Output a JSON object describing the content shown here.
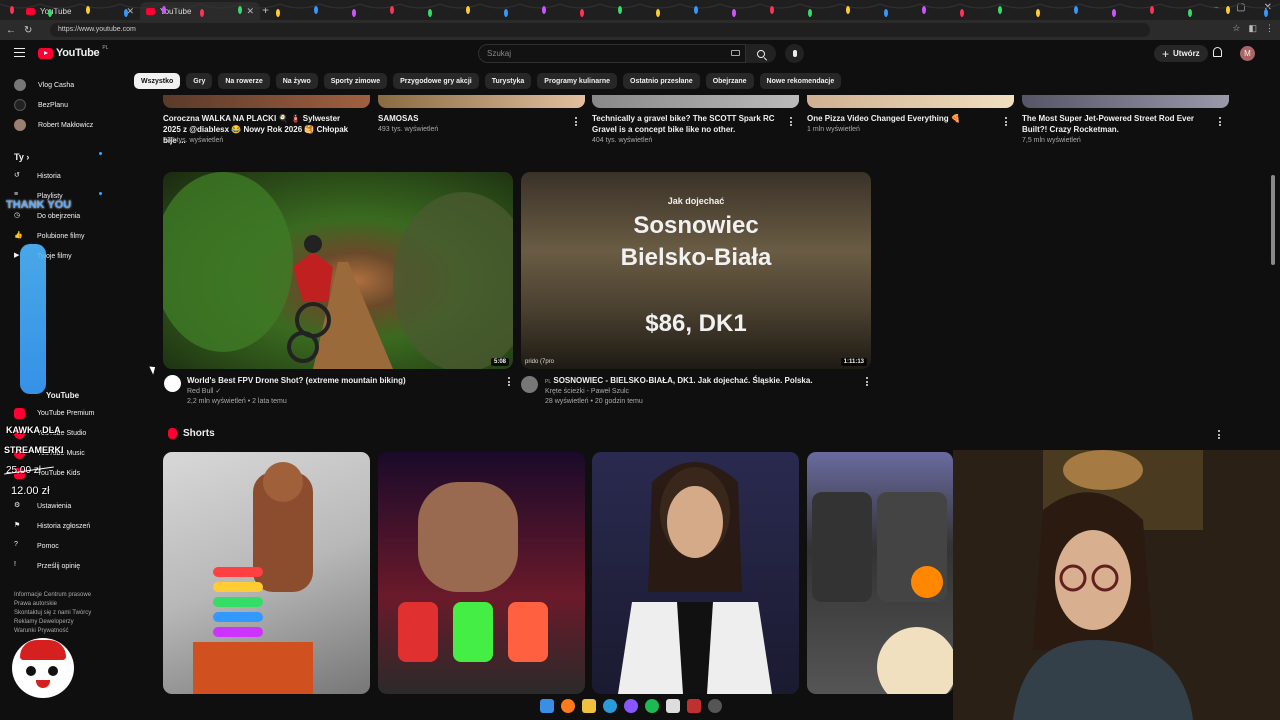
{
  "browser": {
    "tabs": [
      {
        "title": "YouTube",
        "active": false
      },
      {
        "title": "YouTube",
        "active": true
      }
    ],
    "url": "https://www.youtube.com"
  },
  "header": {
    "logo_text": "YouTube",
    "logo_country": "PL",
    "search_placeholder": "Szukaj",
    "create_label": "Utwórz",
    "avatar_letter": "M"
  },
  "chips": [
    "Wszystko",
    "Gry",
    "Na rowerze",
    "Na żywo",
    "Sporty zimowe",
    "Przygodowe gry akcji",
    "Turystyka",
    "Programy kulinarne",
    "Ostatnio przesłane",
    "Obejrzane",
    "Nowe rekomendacje"
  ],
  "sidebar": {
    "subscriptions": [
      {
        "name": "Vlog Casha",
        "live": true
      },
      {
        "name": "BezPlanu",
        "live": false
      },
      {
        "name": "Robert Makłowicz",
        "live": true
      }
    ],
    "you_heading": "Ty",
    "you_items": [
      "Historia",
      "Playlisty",
      "Do obejrzenia",
      "Polubione filmy",
      "Twoje filmy"
    ],
    "more_from_heading": "YouTube",
    "more_from": [
      "YouTube Premium",
      "YouTube Studio",
      "YouTube Music",
      "YouTube Kids"
    ],
    "settings_items": [
      "Ustawienia",
      "Historia zgłoszeń",
      "Pomoc",
      "Prześlij opinię"
    ],
    "footer_lines": [
      "Informacje  Centrum prasowe",
      "Prawa autorskie",
      "Skontaktuj się z nami  Twórcy",
      "Reklamy  Deweloperzy",
      "",
      "Warunki  Prywatność"
    ]
  },
  "overlay": {
    "thank_text": "THANK YOU",
    "promo_line1": "KAWKA DLA",
    "promo_line2": "STREAMERKI",
    "price_old": "25.00 zł",
    "price_new": "12.00 zł"
  },
  "top_row": [
    {
      "title": "Coroczna WALKA NA PLACKI 🍳 🧯 Sylwester 2025 z @diablesx 😂 Nowy Rok 2026 🥞 Chłopak bije ...",
      "meta": "235 tys. wyświetleń"
    },
    {
      "title": "SAMOSAS",
      "meta": "493 tys. wyświetleń"
    },
    {
      "title": "Technically a gravel bike? The SCOTT Spark RC Gravel is a concept bike like no other.",
      "meta": "404 tys. wyświetleń"
    },
    {
      "title": "One Pizza Video Changed Everything 🍕",
      "meta": "1 mln wyświetleń"
    },
    {
      "title": "The Most Super Jet-Powered Street Rod Ever Built?! Crazy Rocketman.",
      "meta": "7,5 mln wyświetleń"
    }
  ],
  "videos": [
    {
      "title": "World's Best FPV Drone Shot? (extreme mountain biking)",
      "channel": "Red Bull",
      "meta": "2,2 mln wyświetleń • 2 lata temu",
      "duration": "5:08"
    },
    {
      "title": "SOSNOWIEC - BIELSKO-BIAŁA, DK1. Jak dojechać. Śląskie. Polska.",
      "channel": "Kręte ścieżki - Paweł Szulc",
      "meta": "28 wyświetleń • 20 godzin temu",
      "duration": "1:11:13",
      "title_prefix": "PL",
      "thumb_text1": "Jak dojechać",
      "thumb_text2": "Sosnowiec",
      "thumb_text3": "Bielsko-Biała",
      "thumb_text4": "$86, DK1",
      "thumb_corner": "prido  (7pro"
    }
  ],
  "shorts_heading": "Shorts",
  "colors": {
    "accent": "#ff0033",
    "bg": "#0f0f0f",
    "chip": "#272727"
  }
}
